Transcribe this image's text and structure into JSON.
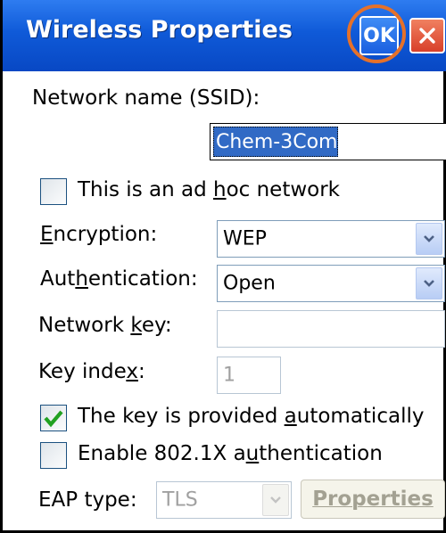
{
  "window": {
    "title": "Wireless Properties",
    "ok_label": "OK"
  },
  "form": {
    "ssid_label": "Network name (SSID):",
    "ssid_value": "Chem-3Com",
    "adhoc_label_pre": "This is an ad ",
    "adhoc_label_u": "h",
    "adhoc_label_post": "oc network",
    "adhoc_checked": false,
    "encryption_label_u": "E",
    "encryption_label_post": "ncryption:",
    "encryption_value": "WEP",
    "auth_label_pre": "Aut",
    "auth_label_u": "h",
    "auth_label_post": "entication:",
    "auth_value": "Open",
    "netkey_label_pre": "Network ",
    "netkey_label_u": "k",
    "netkey_label_post": "ey:",
    "netkey_value": "",
    "keyindex_label_pre": "Key inde",
    "keyindex_label_u": "x",
    "keyindex_label_post": ":",
    "keyindex_value": "1",
    "autokey_label_pre": "The key is provided ",
    "autokey_label_u": "a",
    "autokey_label_post": "utomatically",
    "autokey_checked": true,
    "ieee8021x_label_pre": "Enable 802.1X a",
    "ieee8021x_label_u": "u",
    "ieee8021x_label_post": "thentication",
    "ieee8021x_checked": false,
    "eap_label": "EAP type:",
    "eap_value": "TLS",
    "properties_label": "Properties"
  },
  "colors": {
    "title_bar": "#0f5ad8",
    "highlight_ring": "#e5712a",
    "selection": "#316ac5",
    "check_mark": "#21a121"
  }
}
